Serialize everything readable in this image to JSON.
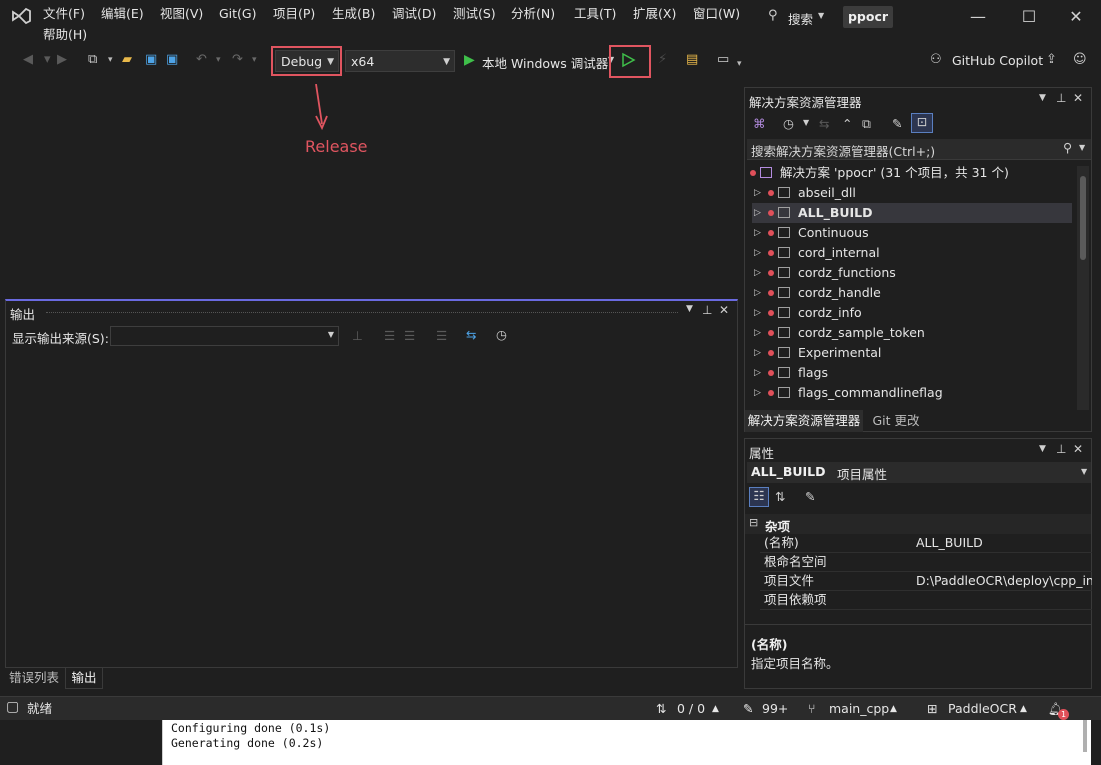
{
  "titlebar": {
    "menu": [
      "文件(F)",
      "编辑(E)",
      "视图(V)",
      "Git(G)",
      "项目(P)",
      "生成(B)",
      "调试(D)",
      "测试(S)",
      "分析(N)",
      "工具(T)",
      "扩展(X)",
      "窗口(W)",
      "帮助(H)"
    ],
    "search_label": "搜索",
    "solution_name": "ppocr"
  },
  "toolbar": {
    "configuration": "Debug",
    "platform": "x64",
    "run_label": "本地 Windows 调试器",
    "copilot_label": "GitHub Copilot"
  },
  "annotation": {
    "arrow_label": "Release",
    "color": "#e05560"
  },
  "output_panel": {
    "title": "输出",
    "source_label": "显示输出来源(S):",
    "source_value": "",
    "tabs": [
      "错误列表",
      "输出"
    ],
    "active_tab": "输出"
  },
  "solution_explorer": {
    "title": "解决方案资源管理器",
    "search_placeholder": "搜索解决方案资源管理器(Ctrl+;)",
    "root_label": "解决方案 'ppocr' (31 个项目，共 31 个)",
    "items": [
      "abseil_dll",
      "ALL_BUILD",
      "Continuous",
      "cord_internal",
      "cordz_functions",
      "cordz_handle",
      "cordz_info",
      "cordz_sample_token",
      "Experimental",
      "flags",
      "flags_commandlineflag"
    ],
    "selected": "ALL_BUILD",
    "bottom_tabs": [
      "解决方案资源管理器",
      "Git 更改"
    ]
  },
  "properties": {
    "title": "属性",
    "object": "ALL_BUILD",
    "object_type": "项目属性",
    "category": "杂项",
    "rows": [
      {
        "key": "(名称)",
        "value": "ALL_BUILD"
      },
      {
        "key": "根命名空间",
        "value": ""
      },
      {
        "key": "项目文件",
        "value": "D:\\PaddleOCR\\deploy\\cpp_inf"
      },
      {
        "key": "项目依赖项",
        "value": ""
      }
    ],
    "desc_title": "(名称)",
    "desc_text": "指定项目名称。"
  },
  "statusbar": {
    "status": "就绪",
    "changes": "0 / 0",
    "count": "99+",
    "branch": "main_cpp",
    "repo": "PaddleOCR",
    "notification_badge": "1"
  },
  "terminal": {
    "lines": [
      "Configuring done (0.1s)",
      "Generating done (0.2s)"
    ]
  }
}
